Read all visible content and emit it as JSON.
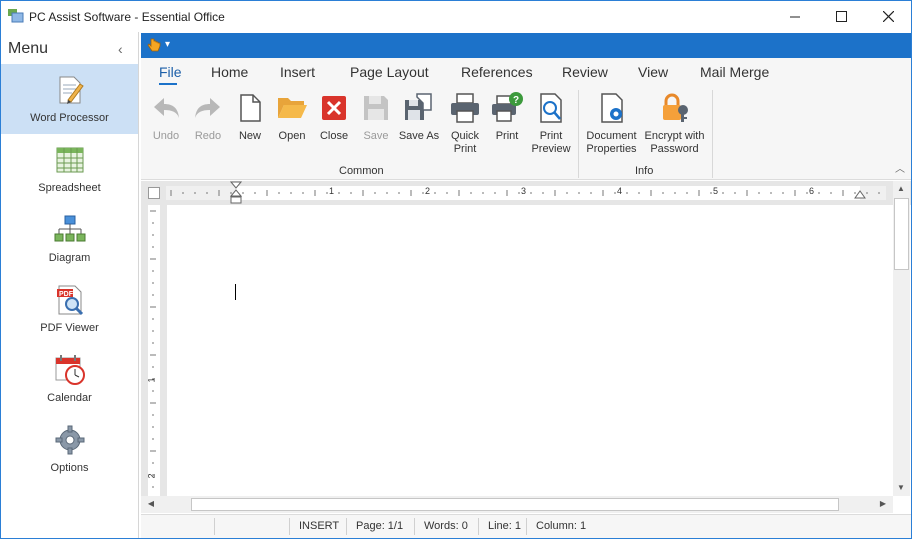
{
  "window": {
    "title": "PC Assist Software - Essential Office"
  },
  "sidebar": {
    "title": "Menu",
    "collapse_glyph": "‹",
    "items": [
      {
        "label": "Word Processor",
        "icon": "word-processor-icon",
        "active": true
      },
      {
        "label": "Spreadsheet",
        "icon": "spreadsheet-icon",
        "active": false
      },
      {
        "label": "Diagram",
        "icon": "diagram-icon",
        "active": false
      },
      {
        "label": "PDF Viewer",
        "icon": "pdf-viewer-icon",
        "active": false
      },
      {
        "label": "Calendar",
        "icon": "calendar-icon",
        "active": false
      },
      {
        "label": "Options",
        "icon": "gear-icon",
        "active": false
      }
    ]
  },
  "ribbon": {
    "tabs": [
      "File",
      "Home",
      "Insert",
      "Page Layout",
      "References",
      "Review",
      "View",
      "Mail Merge"
    ],
    "active_tab": "File",
    "groups": [
      {
        "label": "Common",
        "buttons": [
          {
            "label": "Undo",
            "icon": "undo-icon",
            "enabled": false
          },
          {
            "label": "Redo",
            "icon": "redo-icon",
            "enabled": false
          },
          {
            "label": "New",
            "icon": "new-document-icon",
            "enabled": true
          },
          {
            "label": "Open",
            "icon": "folder-open-icon",
            "enabled": true
          },
          {
            "label": "Close",
            "icon": "close-document-icon",
            "enabled": true
          },
          {
            "label": "Save",
            "icon": "save-icon",
            "enabled": false
          },
          {
            "label": "Save As",
            "icon": "save-as-icon",
            "enabled": true
          },
          {
            "label": "Quick Print",
            "icon": "quick-print-icon",
            "enabled": true
          },
          {
            "label": "Print",
            "icon": "print-icon",
            "enabled": true
          },
          {
            "label": "Print Preview",
            "icon": "print-preview-icon",
            "enabled": true
          }
        ]
      },
      {
        "label": "Info",
        "buttons": [
          {
            "label": "Document Properties",
            "icon": "document-properties-icon",
            "enabled": true
          },
          {
            "label": "Encrypt with Password",
            "icon": "encrypt-password-icon",
            "enabled": true
          }
        ]
      }
    ]
  },
  "ruler": {
    "horizontal_numbers": [
      "1",
      "2",
      "3",
      "4",
      "5",
      "6"
    ],
    "vertical_numbers": [
      "1",
      "2"
    ]
  },
  "statusbar": {
    "mode": "INSERT",
    "page": "Page: 1/1",
    "words": "Words: 0",
    "line": "Line: 1",
    "column": "Column: 1"
  },
  "colors": {
    "accent": "#1c72c9",
    "active_nav": "#cce0f5",
    "ribbon_bg": "#f6f6f6"
  }
}
